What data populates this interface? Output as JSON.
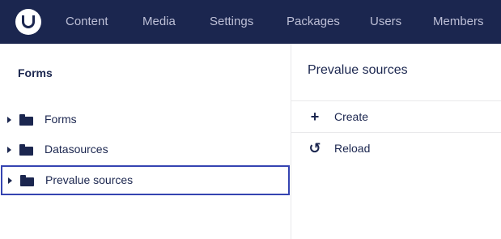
{
  "nav": {
    "items": [
      {
        "label": "Content"
      },
      {
        "label": "Media"
      },
      {
        "label": "Settings"
      },
      {
        "label": "Packages"
      },
      {
        "label": "Users"
      },
      {
        "label": "Members"
      }
    ]
  },
  "tree": {
    "title": "Forms",
    "items": [
      {
        "label": "Forms",
        "icon": "folder-icon"
      },
      {
        "label": "Datasources",
        "icon": "folder-icon"
      },
      {
        "label": "Prevalue sources",
        "icon": "folder-icon",
        "selected": true
      }
    ]
  },
  "actions": {
    "title": "Prevalue sources",
    "items": [
      {
        "label": "Create",
        "icon": "plus-icon",
        "glyph": "+"
      },
      {
        "label": "Reload",
        "icon": "reload-icon",
        "glyph": "↺"
      }
    ]
  },
  "colors": {
    "navbar": "#1b264f",
    "nav_text": "#bdbfd6",
    "selected_border": "#3544b1"
  }
}
